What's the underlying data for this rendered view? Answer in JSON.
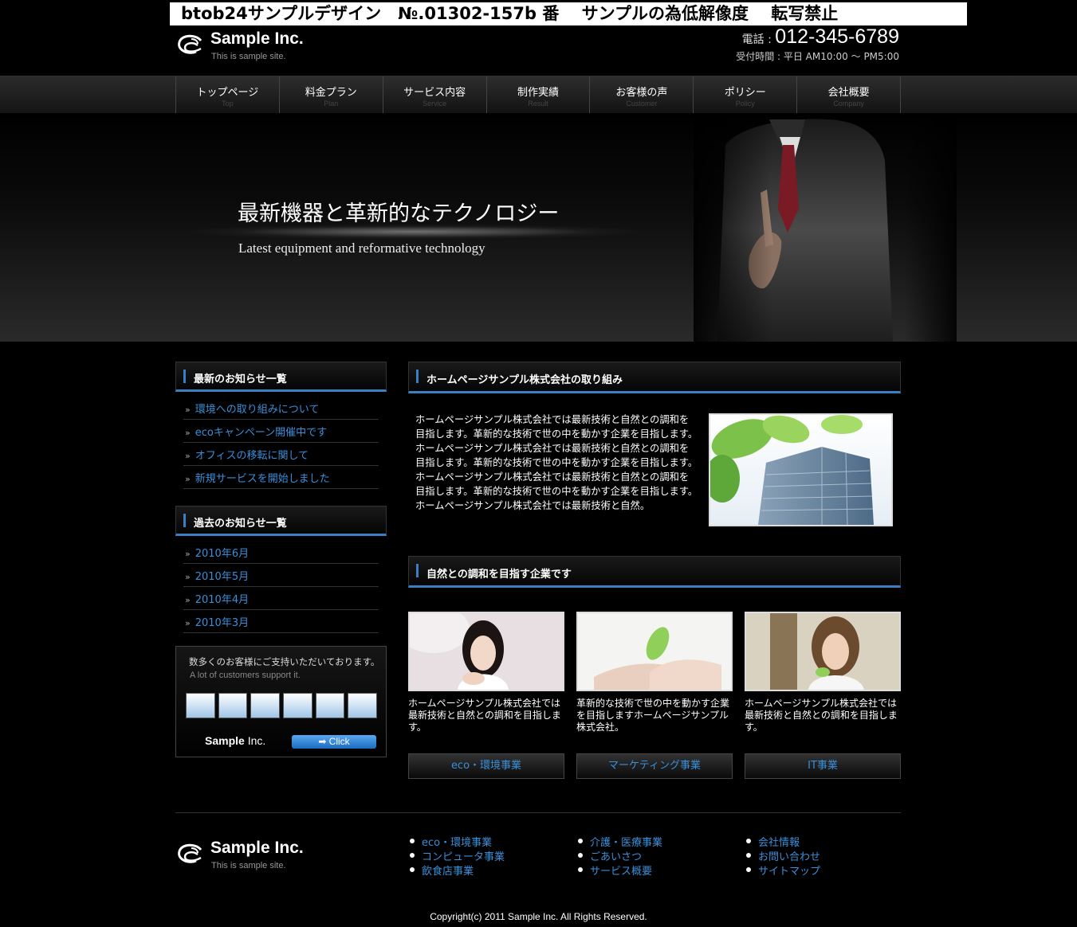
{
  "banner": "btob24サンプルデザイン　№.01302-157b 番　 サンプルの為低解像度　 転写禁止",
  "header": {
    "logo_name": "Sample Inc.",
    "logo_tagline": "This is sample site.",
    "tel_label": "電話 : ",
    "tel_number": "012-345-6789",
    "hours": "受付時間 : 平日 AM10:00 ～ PM5:00"
  },
  "nav": [
    {
      "jp": "トップページ",
      "en": "Top"
    },
    {
      "jp": "料金プラン",
      "en": "Plan"
    },
    {
      "jp": "サービス内容",
      "en": "Service"
    },
    {
      "jp": "制作実績",
      "en": "Result"
    },
    {
      "jp": "お客様の声",
      "en": "Customer"
    },
    {
      "jp": "ポリシー",
      "en": "Policy"
    },
    {
      "jp": "会社概要",
      "en": "Company"
    }
  ],
  "hero": {
    "title": "最新機器と革新的なテクノロジー",
    "subtitle": "Latest equipment and reformative technology"
  },
  "sidebar": {
    "latest_title": "最新のお知らせ一覧",
    "latest_items": [
      "環境への取り組みについて",
      "ecoキャンペーン開催中です",
      "オフィスの移転に関して",
      "新規サービスを開始しました"
    ],
    "past_title": "過去のお知らせ一覧",
    "past_items": [
      "2010年6月",
      "2010年5月",
      "2010年4月",
      "2010年3月"
    ],
    "bullet": "»",
    "promo": {
      "title": "数多くのお客様にご支持いただいております。",
      "subtitle": "A lot of customers support it.",
      "logo_bold": "Sample",
      "logo_rest": " Inc.",
      "click_label": "➡ Click"
    }
  },
  "main": {
    "intro_title": "ホームページサンプル株式会社の取り組み",
    "intro_text": "ホームページサンプル株式会社では最新技術と自然との調和を目指します。革新的な技術で世の中を動かす企業を目指します。ホームページサンプル株式会社では最新技術と自然との調和を目指します。革新的な技術で世の中を動かす企業を目指します。ホームページサンプル株式会社では最新技術と自然との調和を目指します。革新的な技術で世の中を動かす企業を目指します。ホームページサンプル株式会社では最新技術と自然。",
    "nature_title": "自然との調和を目指す企業です",
    "cards": [
      {
        "text": "ホームページサンプル株式会社では最新技術と自然との調和を目指します。",
        "button": "eco・環境事業"
      },
      {
        "text": "革新的な技術で世の中を動かす企業を目指しますホームページサンプル株式会社。",
        "button": "マーケティング事業"
      },
      {
        "text": "ホームページサンプル株式会社では最新技術と自然との調和を目指します。",
        "button": "IT事業"
      }
    ]
  },
  "footer": {
    "col1": [
      "eco・環境事業",
      "コンピュータ事業",
      "飲食店事業"
    ],
    "col2": [
      "介護・医療事業",
      "ごあいさつ",
      "サービス概要"
    ],
    "col3": [
      "会社情報",
      "お問い合わせ",
      "サイトマップ"
    ],
    "copyright": "Copyright(c) 2011 Sample Inc. All Rights Reserved."
  },
  "colors": {
    "accent": "#3a8fd8",
    "bar": "#3a7fc1",
    "background": "#000000"
  }
}
